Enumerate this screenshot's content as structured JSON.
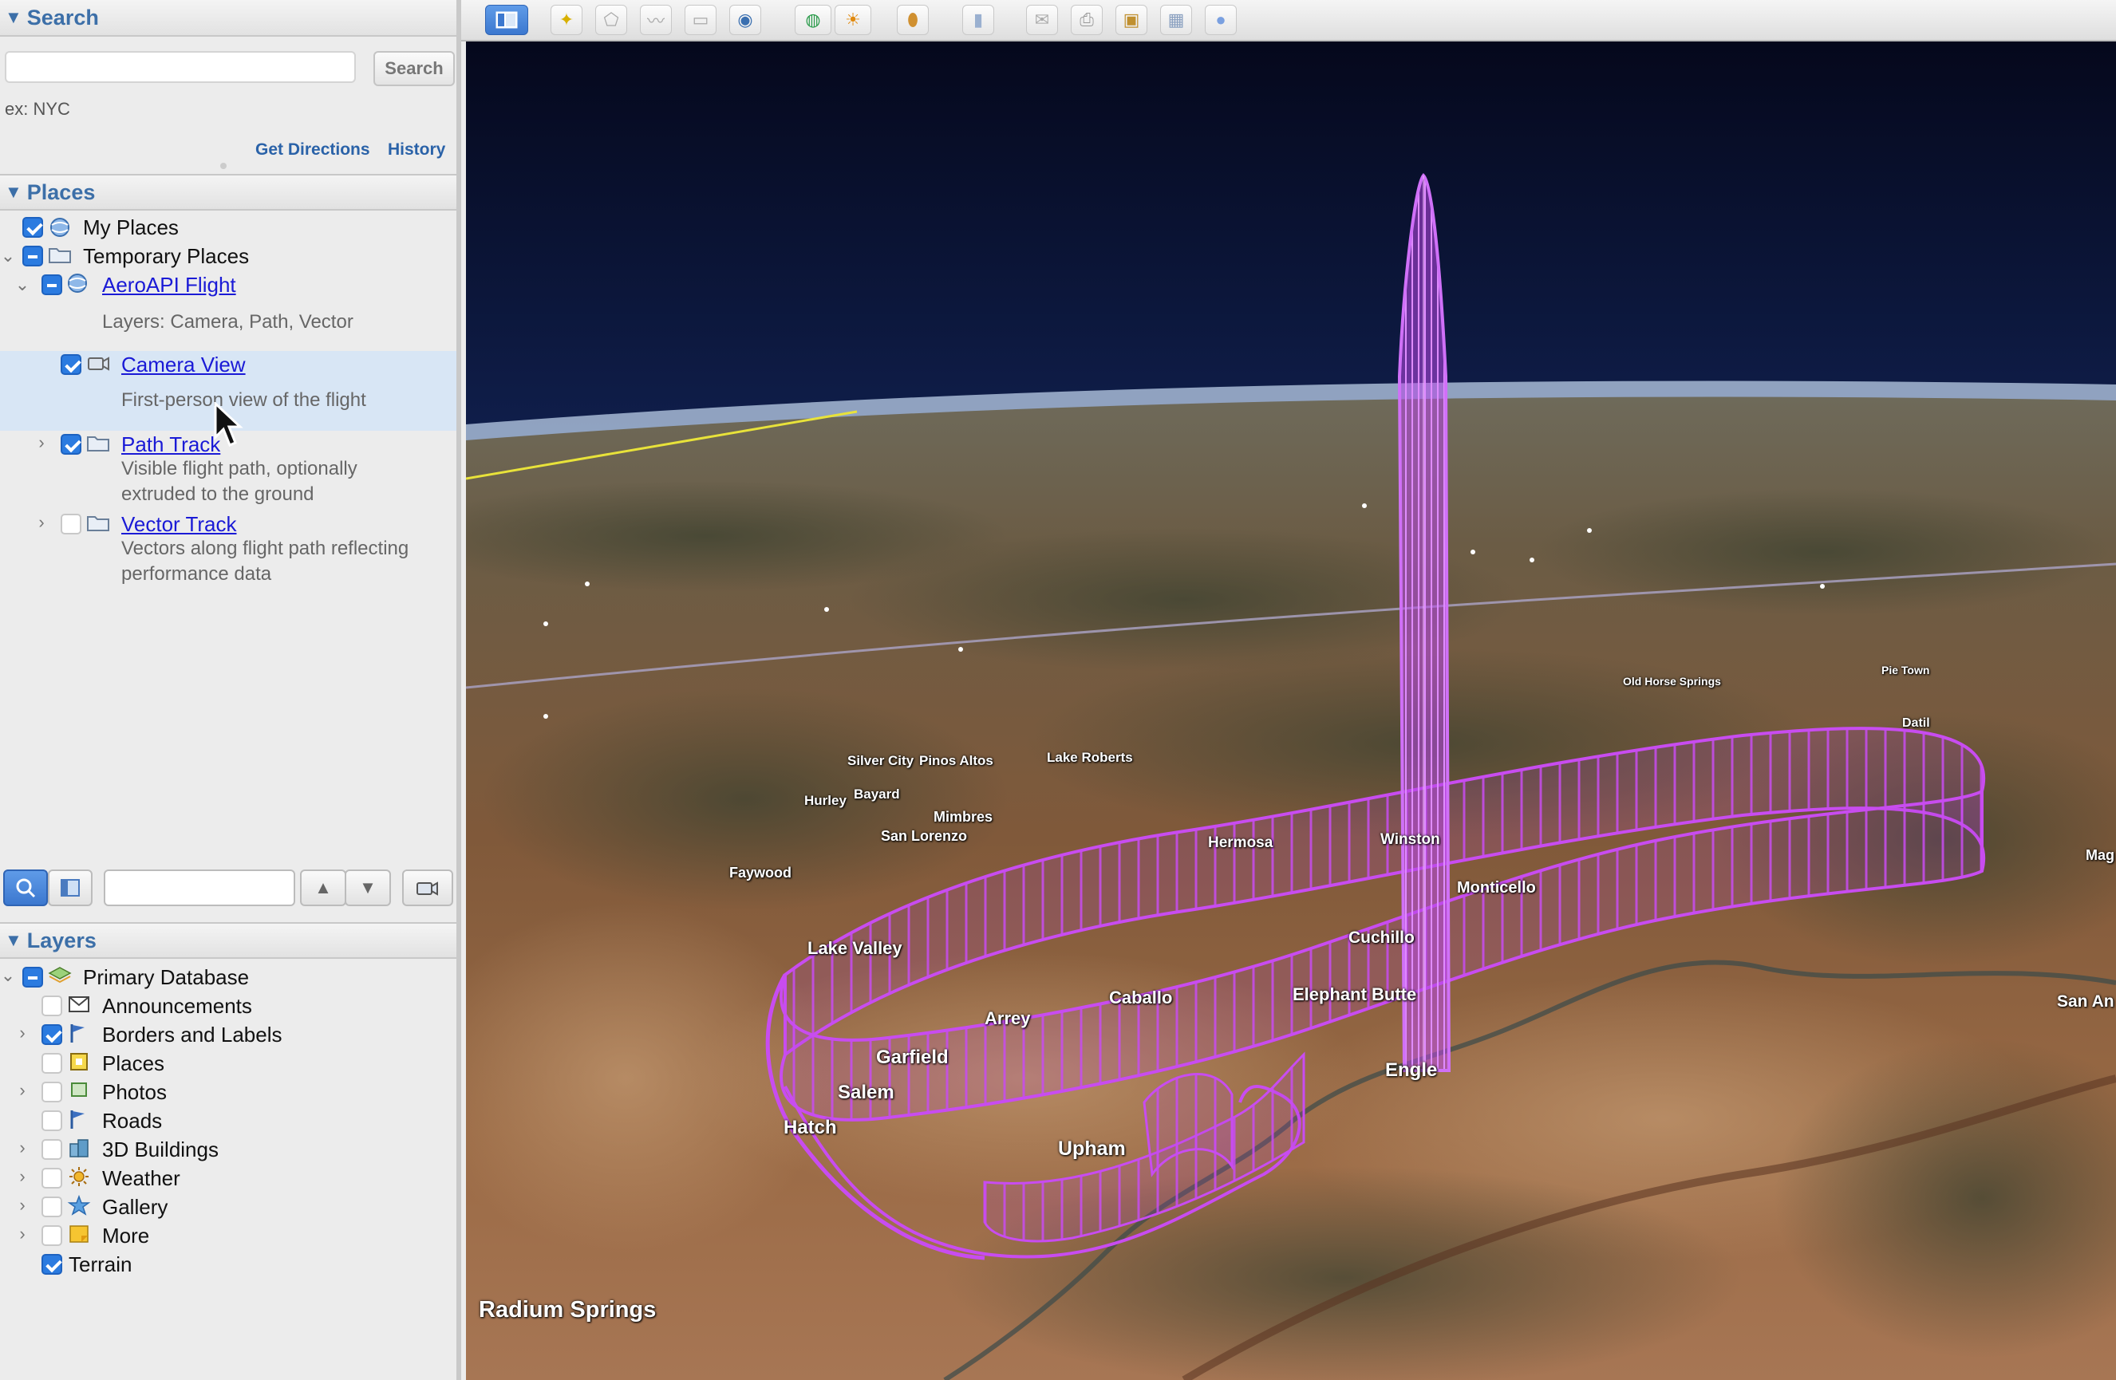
{
  "search": {
    "header": "Search",
    "button": "Search",
    "hint": "ex: NYC",
    "get_directions": "Get Directions",
    "history": "History"
  },
  "places": {
    "header": "Places",
    "my_places": "My Places",
    "temporary_places": "Temporary Places",
    "aeroapi_flight": "AeroAPI Flight",
    "aeroapi_desc": "Layers: Camera, Path, Vector",
    "camera_view": "Camera View",
    "camera_view_desc": "First-person view of the flight",
    "path_track": "Path Track",
    "path_track_desc_1": "Visible flight path, optionally",
    "path_track_desc_2": "extruded to the ground",
    "vector_track": "Vector Track",
    "vector_track_desc_1": "Vectors along flight path reflecting",
    "vector_track_desc_2": "performance data"
  },
  "layers": {
    "header": "Layers",
    "items": [
      {
        "label": "Primary Database",
        "state": "mixed"
      },
      {
        "label": "Announcements",
        "state": "off"
      },
      {
        "label": "Borders and Labels",
        "state": "on"
      },
      {
        "label": "Places",
        "state": "off"
      },
      {
        "label": "Photos",
        "state": "off"
      },
      {
        "label": "Roads",
        "state": "off"
      },
      {
        "label": "3D Buildings",
        "state": "off"
      },
      {
        "label": "Weather",
        "state": "off"
      },
      {
        "label": "Gallery",
        "state": "off"
      },
      {
        "label": "More",
        "state": "off"
      },
      {
        "label": "Terrain",
        "state": "on"
      }
    ]
  },
  "map": {
    "labels": {
      "silver_city": "Silver City",
      "pinos_altos": "Pinos Altos",
      "lake_roberts": "Lake Roberts",
      "hurley": "Hurley",
      "bayard": "Bayard",
      "mimbres": "Mimbres",
      "san_lorenzo": "San Lorenzo",
      "faywood": "Faywood",
      "hermosa": "Hermosa",
      "winston": "Winston",
      "monticello": "Monticello",
      "cuchillo": "Cuchillo",
      "lake_valley": "Lake Valley",
      "arrey": "Arrey",
      "caballo": "Caballo",
      "elephant_butte": "Elephant Butte",
      "garfield": "Garfield",
      "salem": "Salem",
      "engle": "Engle",
      "hatch": "Hatch",
      "upham": "Upham",
      "radium_springs": "Radium Springs",
      "old_horse_springs": "Old Horse Springs",
      "pie_town": "Pie Town",
      "datil": "Datil",
      "mag": "Mag",
      "san_an": "San An"
    }
  },
  "colors": {
    "accent": "#3c6fa8",
    "link": "#1a1ad6",
    "track": "#c040e0"
  }
}
